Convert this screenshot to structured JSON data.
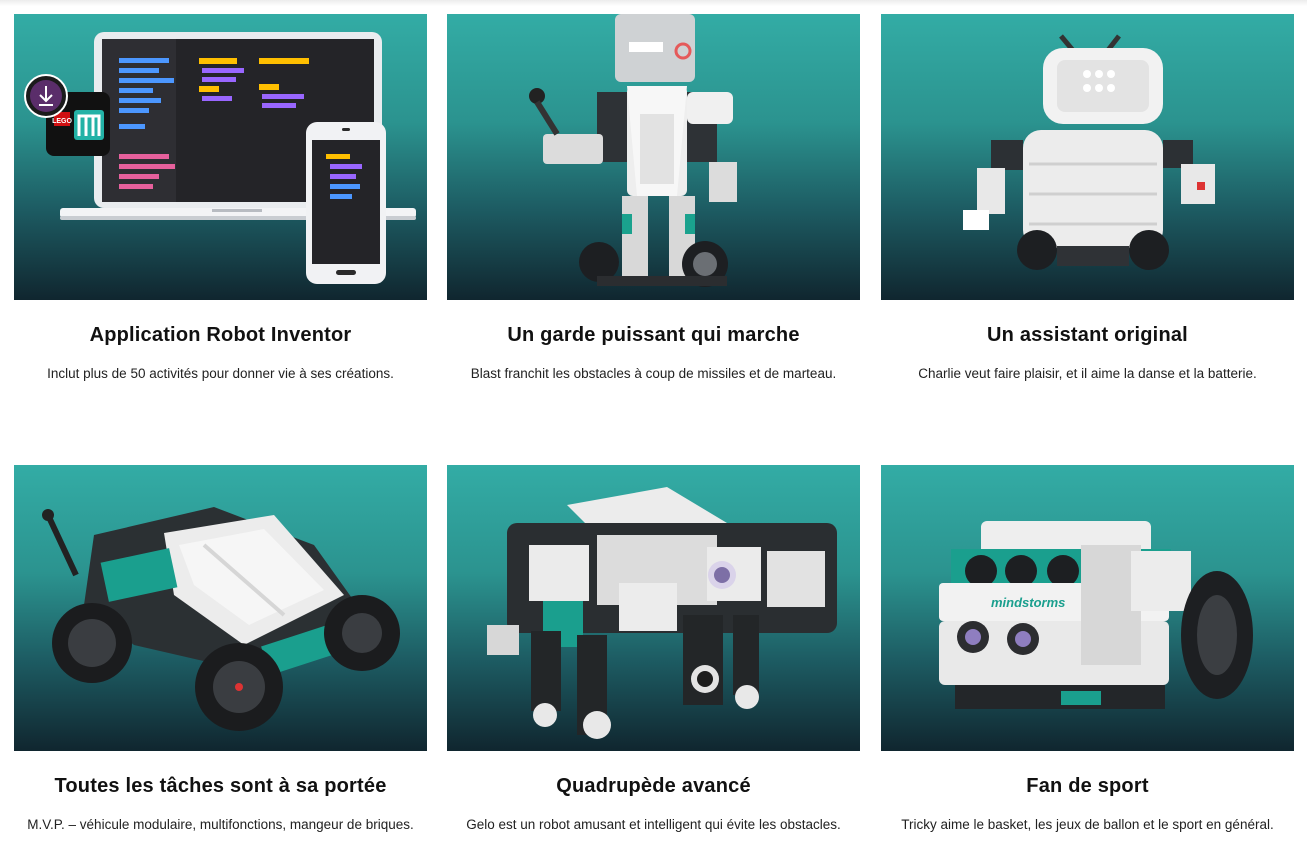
{
  "cards": [
    {
      "title": "Application Robot Inventor",
      "description": "Inclut plus de 50 activités pour donner vie à ses créations.",
      "image_alt": "Application Robot Inventor sur ordinateur portable et smartphone",
      "app_icon": "lego-mindstorms-app-icon",
      "logo_text": "LEGO"
    },
    {
      "title": "Un garde puissant qui marche",
      "description": "Blast franchit les obstacles à coup de missiles et de marteau.",
      "image_alt": "Robot Blast"
    },
    {
      "title": "Un assistant original",
      "description": "Charlie veut faire plaisir, et il aime la danse et la batterie.",
      "image_alt": "Robot Charlie"
    },
    {
      "title": "Toutes les tâches sont à sa portée",
      "description": "M.V.P. – véhicule modulaire, multifonctions, mangeur de briques.",
      "image_alt": "Véhicule M.V.P."
    },
    {
      "title": "Quadrupède avancé",
      "description": "Gelo est un robot amusant et intelligent qui évite les obstacles.",
      "image_alt": "Robot Gelo"
    },
    {
      "title": "Fan de sport",
      "description": "Tricky aime le basket, les jeux de ballon et le sport en général.",
      "image_alt": "Robot Tricky",
      "badge_text": "mindstorms"
    }
  ]
}
